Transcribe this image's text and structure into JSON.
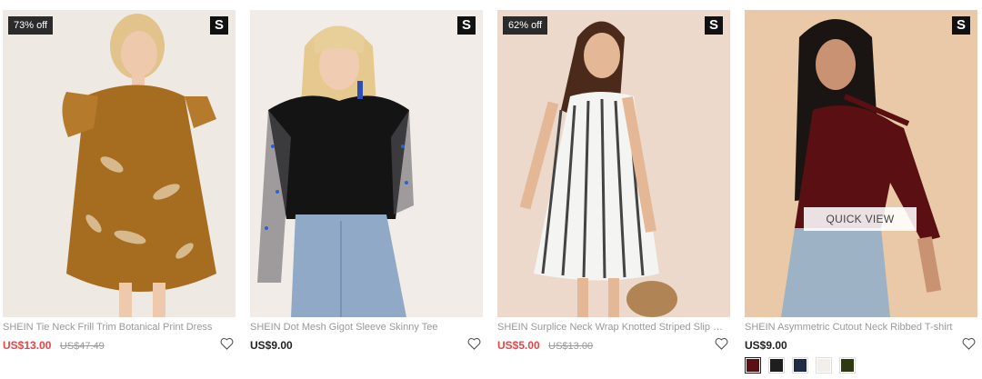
{
  "colors": {
    "sale_price": "#e64545",
    "badge_bg": "#111111",
    "discount_bg": "#2b2b2b"
  },
  "brand_badge": "S",
  "products": [
    {
      "title": "SHEIN Tie Neck Frill Trim Botanical Print Dress",
      "price": "US$13.00",
      "original_price": "US$47.49",
      "discount": "73% off",
      "wishlist_icon": "heart-outline-icon"
    },
    {
      "title": "SHEIN Dot Mesh Gigot Sleeve Skinny Tee",
      "price": "US$9.00",
      "wishlist_icon": "heart-outline-icon"
    },
    {
      "title": "SHEIN Surplice Neck Wrap Knotted Striped Slip Dress",
      "price": "US$5.00",
      "original_price": "US$13.00",
      "discount": "62% off",
      "wishlist_icon": "heart-outline-icon"
    },
    {
      "title": "SHEIN Asymmetric Cutout Neck Ribbed T-shirt",
      "price": "US$9.00",
      "quick_view": "QUICK VIEW",
      "wishlist_icon": "heart-outline-icon",
      "swatches": [
        "#5a0f12",
        "#1e1e1e",
        "#1f2a44",
        "#f2efea",
        "#2f3a12"
      ],
      "selected_swatch": 0
    }
  ]
}
